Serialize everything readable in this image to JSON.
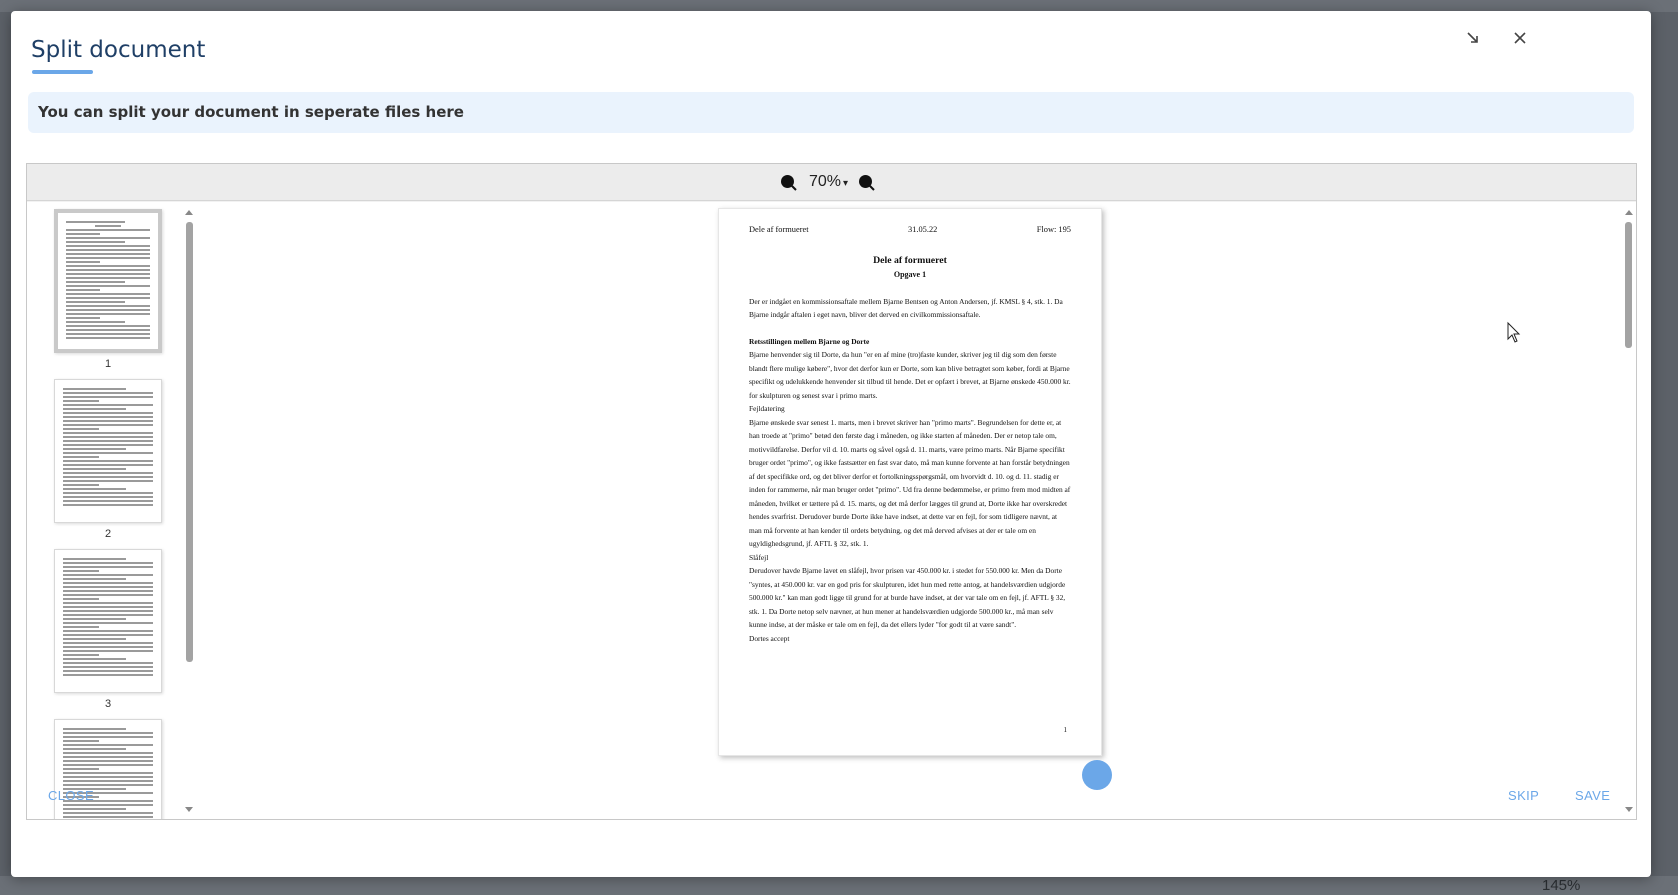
{
  "dialog": {
    "title": "Split document",
    "info": "You can split your document in seperate files here",
    "close_label": "CLOSE",
    "skip_label": "SKIP",
    "save_label": "SAVE"
  },
  "viewer": {
    "zoom": "70%",
    "zoom_caret": "▾",
    "thumbnails": [
      {
        "page": "1"
      },
      {
        "page": "2"
      },
      {
        "page": "3"
      }
    ]
  },
  "document": {
    "header_left": "Dele af formueret",
    "header_center": "31.05.22",
    "header_right": "Flow: 195",
    "title": "Dele af formueret",
    "subtitle": "Opgave 1",
    "intro": "Der er indgået en kommissionsaftale mellem Bjarne Bentsen og Anton Andersen, jf. KMSL § 4, stk. 1. Da Bjarne indgår aftalen i eget navn, bliver det derved en civilkommissionsaftale.",
    "heading1": "Retsstillingen mellem Bjarne og Dorte",
    "para1": "Bjarne henvender sig til Dorte, da hun \"er en af mine (tro)faste kunder, skriver jeg til dig som den første blandt flere mulige købere\", hvor det derfor kun er Dorte, som kan blive betragtet som køber, fordi at Bjarne specifikt og udelukkende henvender sit tilbud til hende. Det er opfært i brevet, at Bjarne ønskede 450.000 kr. for skulpturen og senest svar i primo marts.",
    "heading2": "Fejldatering",
    "para2": "Bjarne ønskede svar senest 1. marts, men i brevet skriver han \"primo marts\". Begrundelsen for dette er, at han troede at \"primo\" betød den første dag i måneden, og ikke starten af måneden. Der er netop tale om, motivvildfarelse. Derfor vil d. 10. marts og såvel også d. 11. marts, være primo marts. Når Bjarne specifikt bruger ordet \"primo\", og ikke fastsætter en fast svar dato, må man kunne forvente at han forstår betydningen af det specifikke ord, og det bliver derfor et fortolkningsspørgsmål, om hvorvidt d. 10. og d. 11. stadig er inden for rammerne, når man bruger ordet \"primo\". Ud fra denne bedømmelse, er primo frem mod midten af måneden, hvilket er tættere på d. 15. marts, og det må derfor lægges til grund at, Dorte ikke har overskredet hendes svarfrist. Derudover burde Dorte ikke have indset, at dette var en fejl, for som tidligere nævnt, at man må forvente at han kender til ordets betydning, og det må derved afvises at der er tale om en ugyldighedsgrund, jf. AFTL § 32, stk. 1.",
    "heading3": "Slåfejl",
    "para3": "Derudover havde Bjarne lavet en slåfejl, hvor prisen var 450.000 kr. i stedet for 550.000 kr. Men da Dorte \"syntes, at 450.000 kr. var en god pris for skulpturen, idet hun med rette antog, at handelsværdien udgjorde 500.000 kr.\" kan man godt ligge til grund for at burde have indset, at der var tale om en fejl, jf. AFTL § 32, stk. 1. Da Dorte netop selv nævner, at hun mener at handelsværdien udgjorde 500.000 kr., må man selv kunne indse, at der måske er tale om en fejl, da det ellers lyder \"for godt til at være sandt\".",
    "heading4": "Dortes accept",
    "page_number": "1"
  },
  "background": {
    "zoom": "145%"
  },
  "colors": {
    "accent": "#6ba7e8",
    "title": "#1f3f66",
    "banner": "#eaf3fd"
  }
}
